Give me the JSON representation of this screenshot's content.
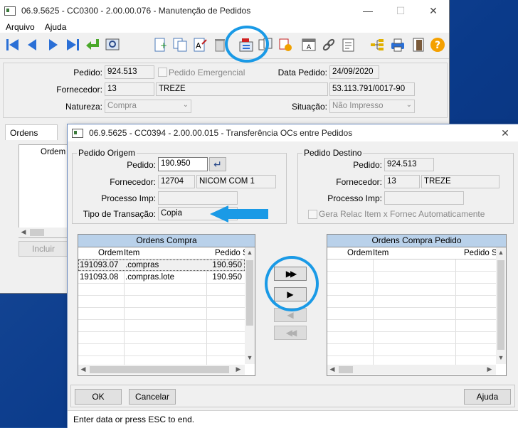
{
  "main_window": {
    "title": "06.9.5625 - CC0300 - 2.00.00.076 - Manutenção de Pedidos",
    "menu": [
      "Arquivo",
      "Ajuda"
    ],
    "pedido_label": "Pedido:",
    "pedido": "924.513",
    "pedido_emergencial": "Pedido Emergencial",
    "data_pedido_label": "Data Pedido:",
    "data_pedido": "24/09/2020",
    "fornecedor_label": "Fornecedor:",
    "fornecedor_code": "13",
    "fornecedor_name": "TREZE",
    "cnpj": "53.113.791/0017-90",
    "natureza_label": "Natureza:",
    "natureza": "Compra",
    "situacao_label": "Situação:",
    "situacao": "Não Impresso",
    "tab_ordens": "Ordens",
    "col_ordem": "Ordem I",
    "incluir": "Incluir"
  },
  "dialog": {
    "title": "06.9.5625 - CC0394 - 2.00.00.015 - Transferência OCs entre Pedidos",
    "origem": {
      "group": "Pedido Origem",
      "pedido_label": "Pedido:",
      "pedido": "190.950",
      "fornecedor_label": "Fornecedor:",
      "fornecedor_code": "12704",
      "fornecedor_name": "NICOM COM 1",
      "processo_label": "Processo Imp:",
      "processo": "",
      "tipo_label": "Tipo de Transação:",
      "tipo": "Copia"
    },
    "destino": {
      "group": "Pedido Destino",
      "pedido_label": "Pedido:",
      "pedido": "924.513",
      "fornecedor_label": "Fornecedor:",
      "fornecedor_code": "13",
      "fornecedor_name": "TREZE",
      "processo_label": "Processo Imp:",
      "processo": "",
      "gera_relac": "Gera Relac Item x Fornec Automaticamente"
    },
    "ordens_compra": {
      "caption": "Ordens Compra",
      "columns": [
        "Ordem",
        "Item",
        "Pedido S"
      ],
      "rows": [
        [
          "191093.07",
          ".compras",
          "190.950"
        ],
        [
          "191093.08",
          ".compras.lote",
          "190.950"
        ]
      ]
    },
    "ordens_compra_pedido": {
      "caption": "Ordens Compra Pedido",
      "columns": [
        "Ordem",
        "Item",
        "Pedido S"
      ],
      "rows": []
    },
    "move_buttons": [
      "▶▶",
      "▶",
      "◀",
      "◀◀"
    ],
    "ok": "OK",
    "cancelar": "Cancelar",
    "ajuda": "Ajuda",
    "status": "Enter data or press ESC to end."
  }
}
